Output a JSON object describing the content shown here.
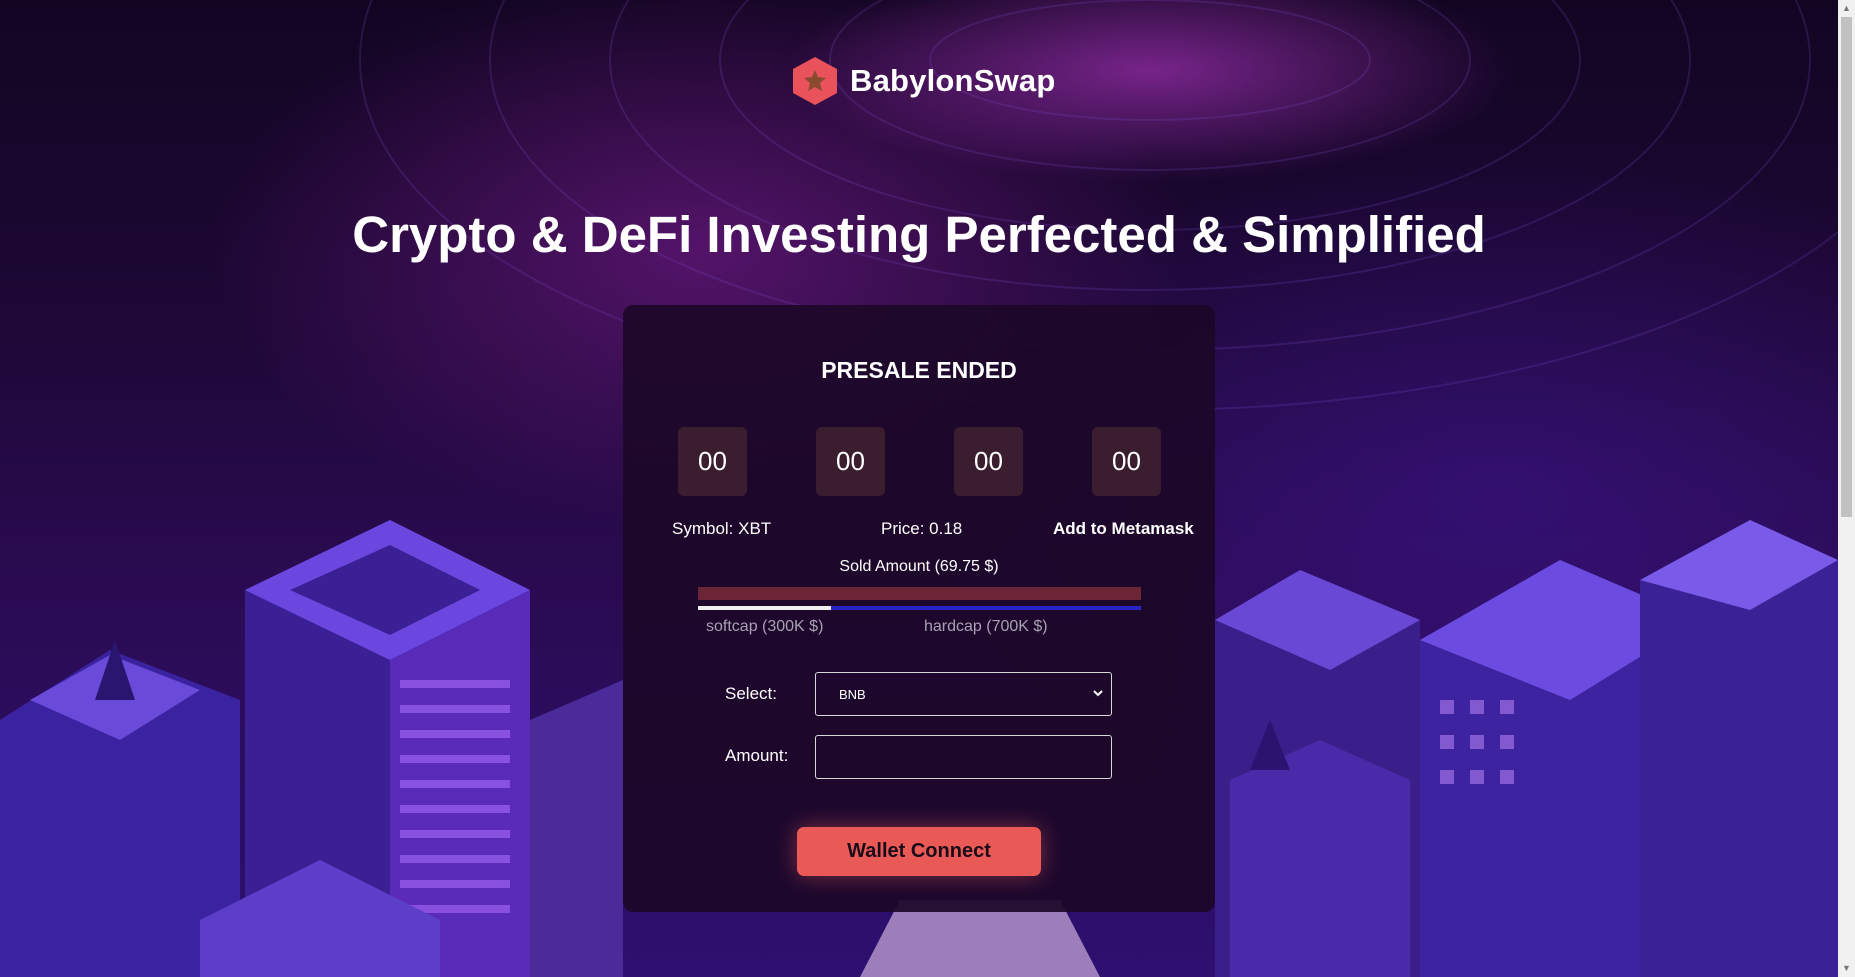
{
  "brand": {
    "name": "BabylonSwap",
    "logo_icon": "hexagon-star-logo-icon",
    "logo_color": "#e9525a",
    "star_color": "#8a4a2f"
  },
  "hero": {
    "headline": "Crypto & DeFi Investing Perfected & Simplified"
  },
  "presale": {
    "status": "PRESALE ENDED",
    "countdown": [
      "00",
      "00",
      "00",
      "00"
    ],
    "symbol_text": "Symbol: XBT",
    "price_text": "Price: 0.18",
    "metamask_link": "Add to Metamask",
    "sold_amount_text": "Sold Amount (69.75 $)",
    "progress_fraction": 0.3,
    "softcap_label": "softcap (300K $)",
    "hardcap_label": "hardcap (700K $)"
  },
  "form": {
    "select_label": "Select:",
    "select_value": "BNB",
    "amount_label": "Amount:",
    "amount_value": ""
  },
  "actions": {
    "wallet_connect_label": "Wallet Connect"
  },
  "colors": {
    "accent": "#e95a57",
    "card_bg": "#1c0828",
    "timer_box": "#3a1e30",
    "bar_track": "#6b2536",
    "bar_line": "#2a24c8"
  }
}
